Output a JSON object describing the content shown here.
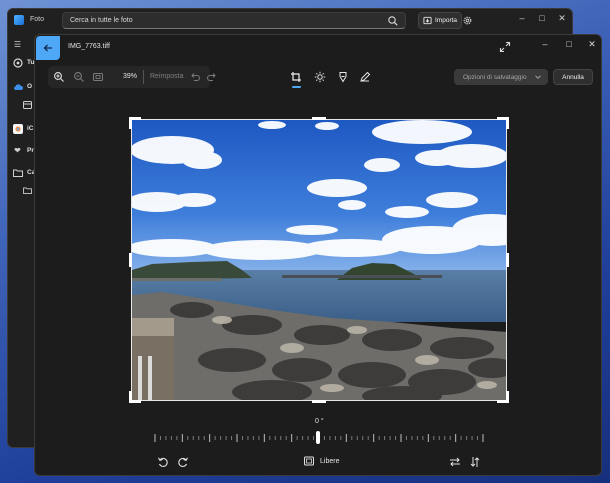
{
  "background_app": {
    "title": "Foto",
    "search_placeholder": "Cerca in tutte le foto",
    "import_label": "Importa",
    "sidebar": {
      "items": [
        {
          "icon": "hamburger-icon",
          "label": ""
        },
        {
          "icon": "photos-icon",
          "label": "Tu"
        },
        {
          "icon": "onedrive-icon",
          "label": "O"
        },
        {
          "icon": "gallery-icon",
          "label": ""
        },
        {
          "icon": "icloud-icon",
          "label": "iC"
        },
        {
          "icon": "heart-icon",
          "label": "Pr"
        },
        {
          "icon": "folder-icon",
          "label": "Ca"
        },
        {
          "icon": "folder-icon",
          "label": ""
        }
      ]
    }
  },
  "editor": {
    "file_name": "IMG_7763.tiff",
    "zoom_percent": "39%",
    "reset_label": "Reimposta",
    "save_options_label": "Opzioni di salvataggio",
    "cancel_label": "Annulla",
    "tools": [
      "crop-icon",
      "brightness-icon",
      "markup-icon",
      "draw-icon"
    ],
    "active_tool": "crop-icon",
    "rotation_angle": "0 °",
    "straighten_value_degrees": 0,
    "aspect_ratio_label": "Libere"
  },
  "colors": {
    "accent": "#4ea8f5",
    "window_bg": "#1c1c1c",
    "save_button_bg": "#3a3a3a"
  }
}
